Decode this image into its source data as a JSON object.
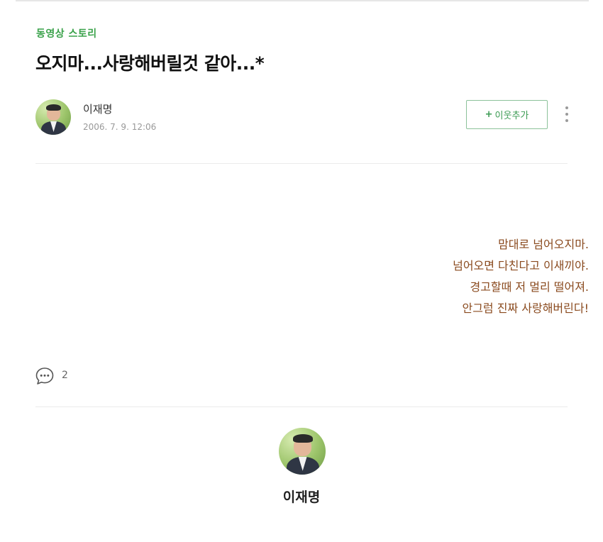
{
  "post": {
    "category": "동영상 스토리",
    "title": "오지마...사랑해버릴것 같아...*"
  },
  "author": {
    "name": "이재명",
    "date": "2006. 7. 9. 12:06",
    "avatar_icon": "author-photo"
  },
  "actions": {
    "follow_plus": "+",
    "follow_label": "이웃추가",
    "more_icon": "more-vertical-icon"
  },
  "body": {
    "lines": [
      "맘대로 넘어오지마.",
      "넘어오면 다친다고 이새끼야.",
      "경고할때 저 멀리 떨어져.",
      "안그럼 진짜 사랑해버린다!"
    ]
  },
  "comments": {
    "icon": "comment-bubble-icon",
    "count": "2"
  },
  "profile": {
    "name": "이재명"
  },
  "colors": {
    "category": "#3aa24a",
    "follow_border": "#8cc29a",
    "follow_text": "#3a9a52",
    "poem_text": "#8a4a1e"
  }
}
